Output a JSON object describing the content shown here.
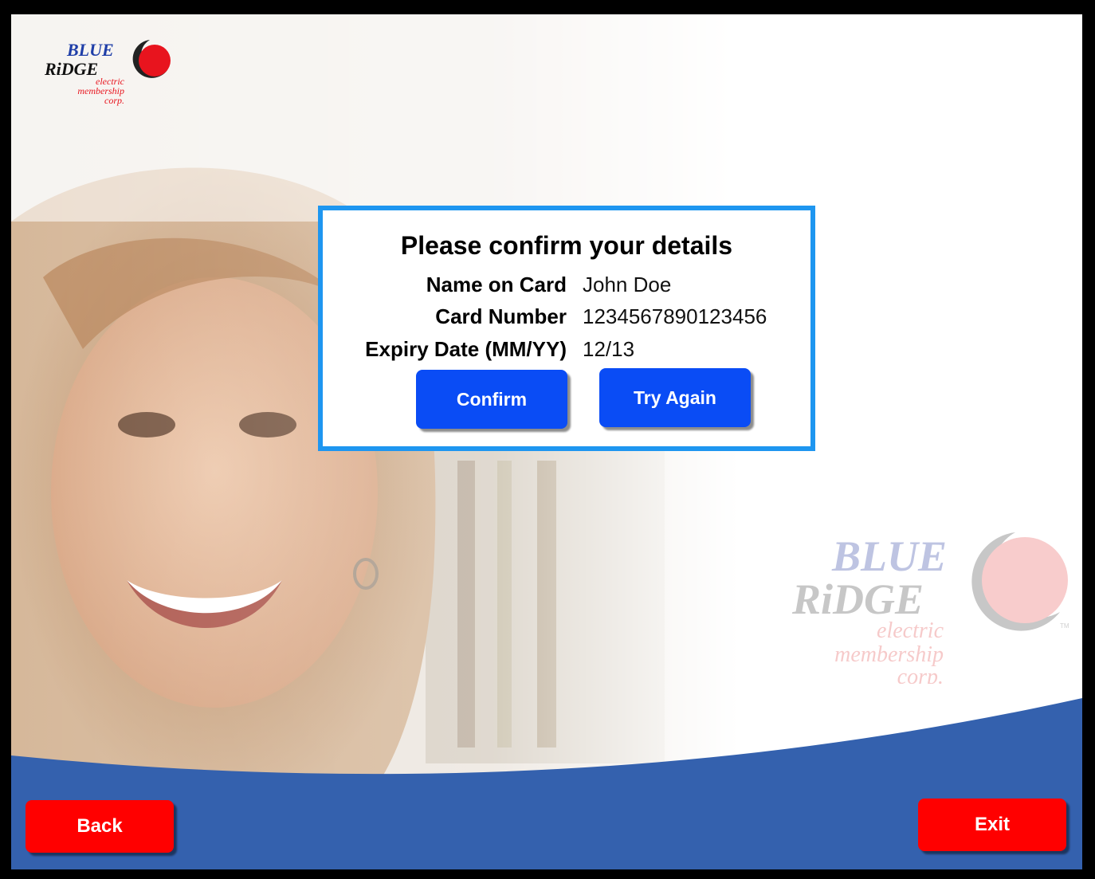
{
  "brand": {
    "line1": "BLUE",
    "line2": "RiDGE",
    "line3": "electric",
    "line4": "membership",
    "line5": "corp.",
    "tm": "TM",
    "blue": "#1f3ea8",
    "red": "#e8141e"
  },
  "dialog": {
    "title": "Please confirm your details",
    "fields": [
      {
        "label": "Name on Card",
        "value": "John Doe"
      },
      {
        "label": "Card Number",
        "value": "1234567890123456"
      },
      {
        "label": "Expiry Date (MM/YY)",
        "value": "12/13"
      }
    ],
    "confirm_label": "Confirm",
    "try_again_label": "Try Again",
    "border_color": "#1e96f0"
  },
  "footer": {
    "back_label": "Back",
    "exit_label": "Exit",
    "bar_color": "#3461ae",
    "button_color": "#ff0000"
  }
}
